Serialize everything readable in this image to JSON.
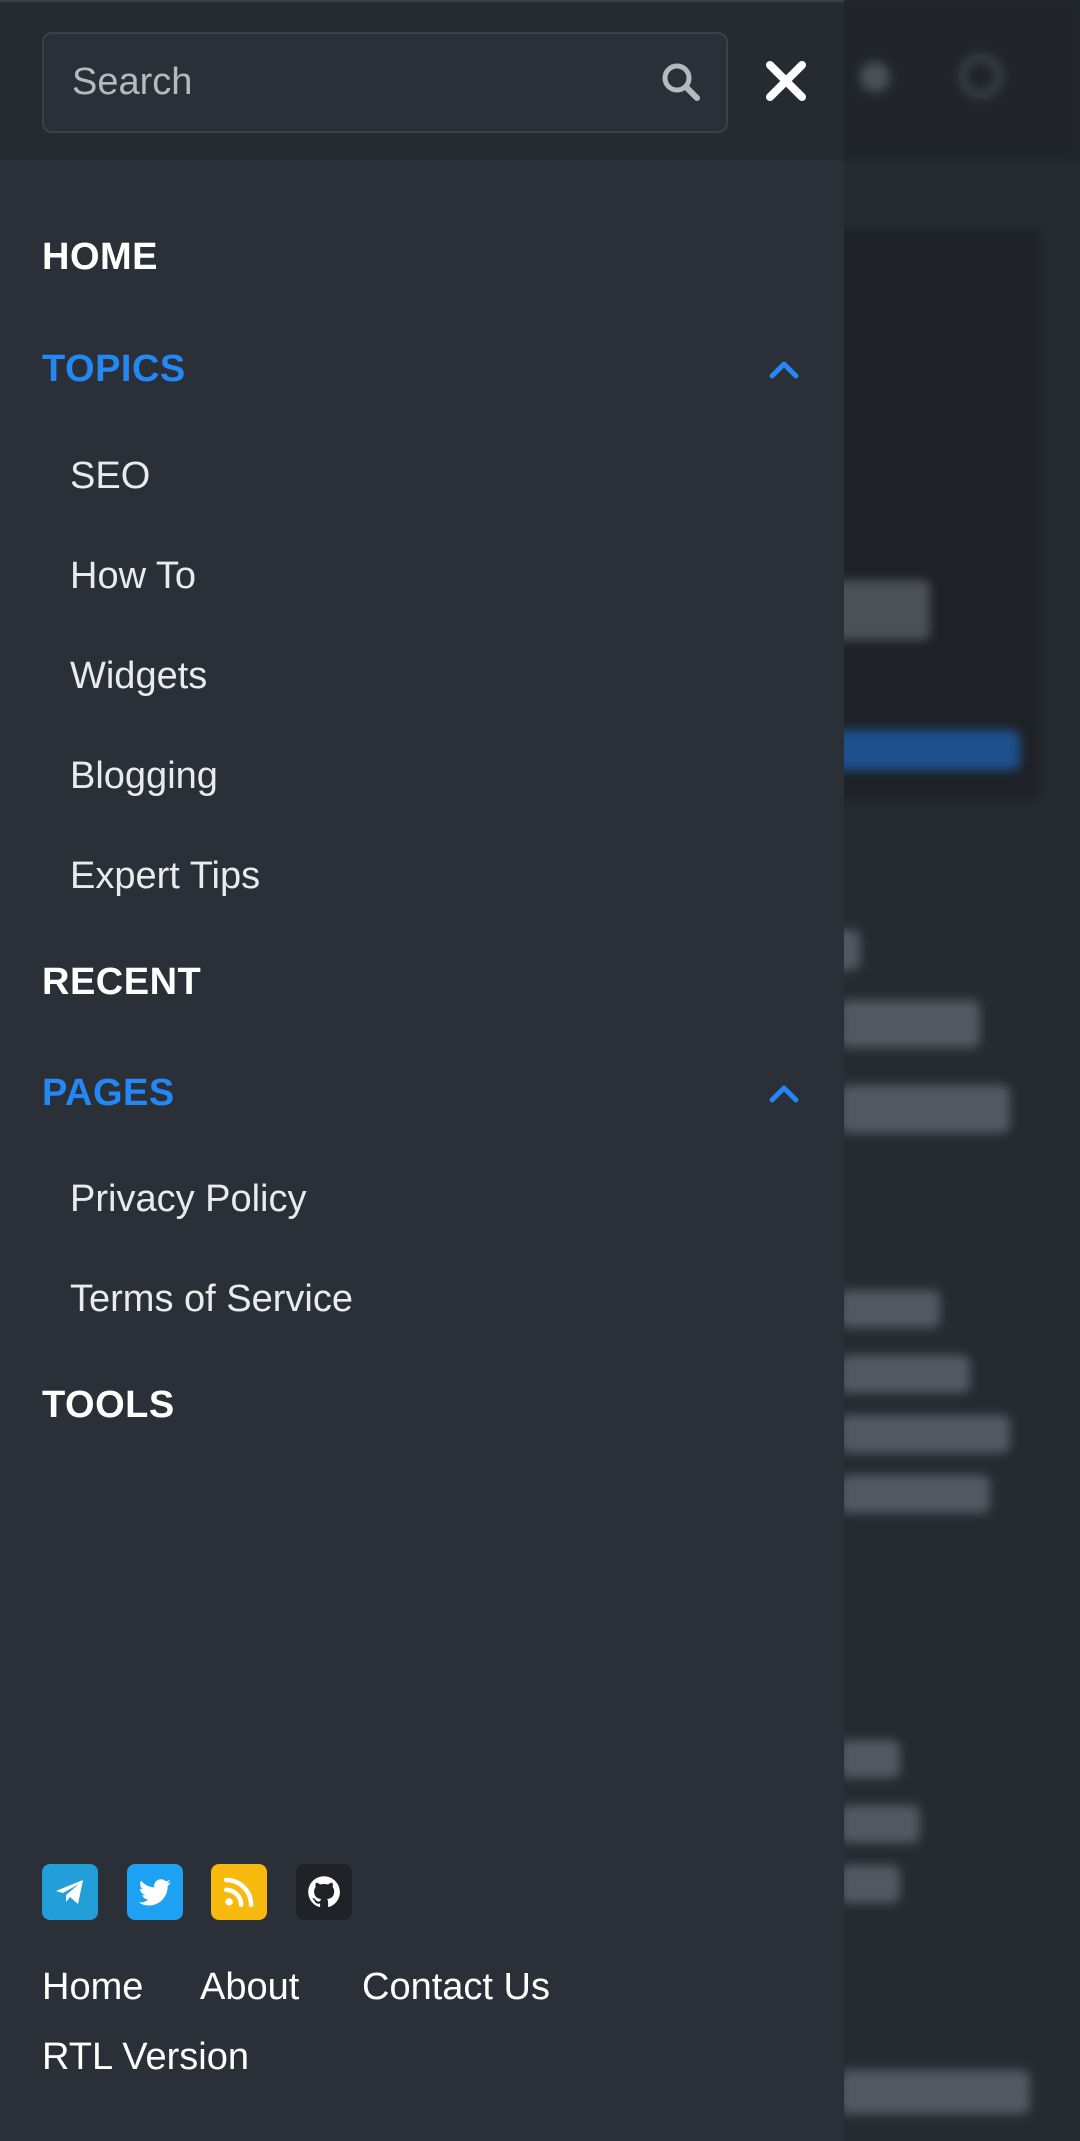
{
  "search": {
    "placeholder": "Search"
  },
  "icons": {
    "search": "search-icon",
    "close": "close-icon",
    "chevron": "chevron-up-icon",
    "telegram": "telegram-icon",
    "twitter": "twitter-icon",
    "rss": "rss-icon",
    "github": "github-icon"
  },
  "colors": {
    "accent": "#2388f4",
    "drawer_bg": "#2b2f37",
    "telegram": "#229ed9",
    "twitter": "#1da1f2",
    "rss": "#f7b90e",
    "github": "#1f2227"
  },
  "menu": {
    "home": "HOME",
    "topics": {
      "label": "TOPICS",
      "items": [
        "SEO",
        "How To",
        "Widgets",
        "Blogging",
        "Expert Tips"
      ]
    },
    "recent": "RECENT",
    "pages": {
      "label": "PAGES",
      "items": [
        "Privacy Policy",
        "Terms of Service"
      ]
    },
    "tools": "TOOLS"
  },
  "footer": {
    "links": [
      "Home",
      "About",
      "Contact Us"
    ],
    "rtl": "RTL Version"
  }
}
